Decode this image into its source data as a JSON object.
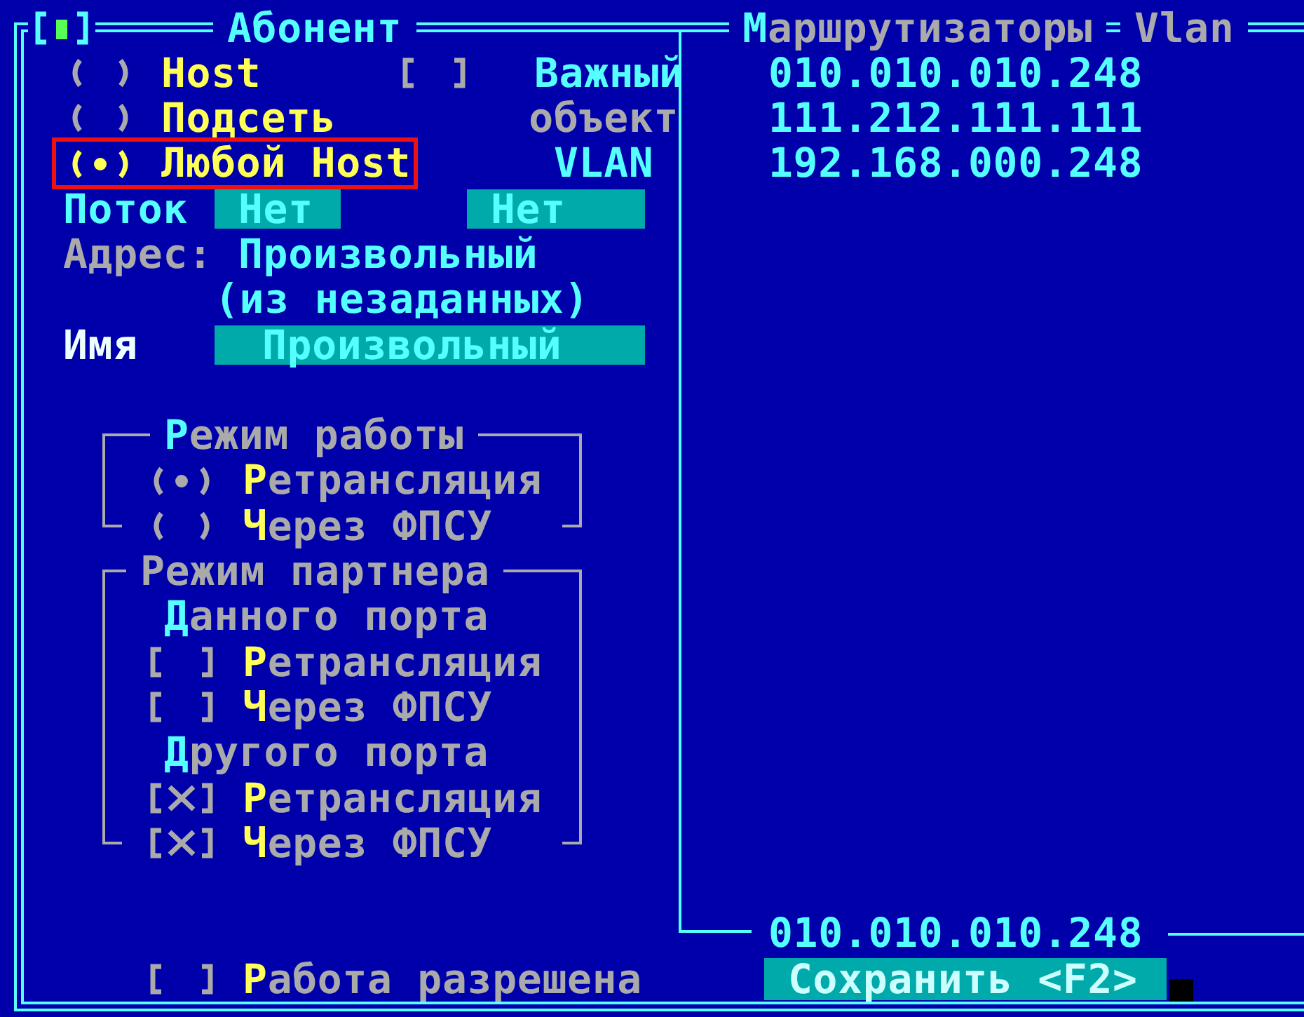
{
  "window": {
    "title": "Абонент"
  },
  "abonent": {
    "focused": true,
    "options": [
      {
        "label": "Host",
        "selected": false,
        "highlighted": false
      },
      {
        "label": "Подсеть",
        "selected": false,
        "highlighted": false
      },
      {
        "label": "Любой Host",
        "selected": true,
        "highlighted": true
      }
    ]
  },
  "important_object": {
    "label_lines": [
      "Важный",
      "объект"
    ],
    "checked": false
  },
  "vlan_label": "VLAN",
  "flow": {
    "label": "Поток",
    "value": "Нет",
    "vlan_value": "Нет"
  },
  "address": {
    "label": "Адрес:",
    "value_lines": [
      "Произвольный",
      "(из незаданных)"
    ]
  },
  "name": {
    "label": "Имя",
    "value": "Произвольный"
  },
  "work_mode": {
    "title": "Режим работы",
    "hotkey": true,
    "focused": false,
    "options": [
      {
        "label": "Ретрансляция",
        "selected": true
      },
      {
        "label": "Через ФПСУ",
        "selected": false
      }
    ]
  },
  "partner_mode": {
    "title": "Режим партнера",
    "hotkey": false,
    "focused": false,
    "sections": [
      {
        "heading": "Данного порта",
        "hotkey": true,
        "options": [
          {
            "label": "Ретрансляция",
            "checked": false
          },
          {
            "label": "Через ФПСУ",
            "checked": false
          }
        ]
      },
      {
        "heading": "Другого порта",
        "hotkey": true,
        "options": [
          {
            "label": "Ретрансляция",
            "checked": true
          },
          {
            "label": "Через ФПСУ",
            "checked": true
          }
        ]
      }
    ]
  },
  "work_enabled": {
    "label": "Работа разрешена",
    "checked": false
  },
  "routers": {
    "title": "Маршрутизаторы",
    "hotkey": true,
    "column_2": "Vlan",
    "items": [
      "010.010.010.248",
      "111.212.111.111",
      "192.168.000.248"
    ],
    "current": "010.010.010.248"
  },
  "save_button": "Сохранить <F2>"
}
